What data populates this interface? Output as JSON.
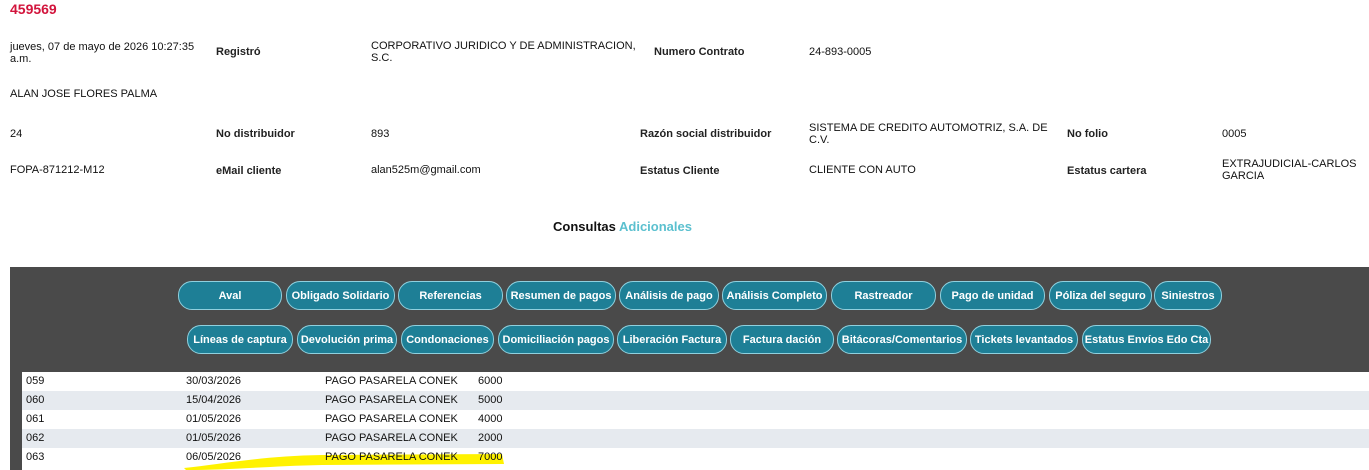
{
  "record": {
    "id": "459569",
    "datetime": "jueves, 07 de mayo de 2026 10:27:35 a.m.",
    "registro_label": "Registró",
    "registro_value": "CORPORATIVO JURIDICO Y DE ADMINISTRACION, S.C.",
    "contrato_label": "Numero Contrato",
    "contrato_value": "24-893-0005",
    "cliente_nombre": "ALAN JOSE FLORES PALMA",
    "num": "24",
    "distribuidor_label": "No distribuidor",
    "distribuidor_value": "893",
    "razon_label": "Razón social distribuidor",
    "razon_value": "SISTEMA DE CREDITO AUTOMOTRIZ, S.A. DE C.V.",
    "folio_label": "No folio",
    "folio_value": "0005",
    "rfc": "FOPA-871212-M12",
    "email_label": "eMail cliente",
    "email_value": "alan525m@gmail.com",
    "estatus_cliente_label": "Estatus Cliente",
    "estatus_cliente_value": "CLIENTE CON AUTO",
    "estatus_cartera_label": "Estatus cartera",
    "estatus_cartera_value": "EXTRAJUDICIAL-CARLOS GARCIA"
  },
  "consultas": {
    "part1": "Consultas",
    "part2": "Adicionales"
  },
  "buttons_row1": [
    "Aval",
    "Obligado Solidario",
    "Referencias",
    "Resumen de pagos",
    "Análisis de pago",
    "Análisis Completo",
    "Rastreador",
    "Pago de unidad",
    "Póliza del seguro",
    "Siniestros"
  ],
  "buttons_row2": [
    "Líneas de captura",
    "Devolución prima",
    "Condonaciones",
    "Domiciliación pagos",
    "Liberación Factura",
    "Factura dación",
    "Bitácoras/Comentarios",
    "Tickets levantados",
    "Estatus Envíos Edo Cta"
  ],
  "payments": [
    {
      "num": "059",
      "date": "30/03/2026",
      "concept": "PAGO PASARELA CONEK",
      "amount": "6000"
    },
    {
      "num": "060",
      "date": "15/04/2026",
      "concept": "PAGO PASARELA CONEK",
      "amount": "5000"
    },
    {
      "num": "061",
      "date": "01/05/2026",
      "concept": "PAGO PASARELA CONEK",
      "amount": "4000"
    },
    {
      "num": "062",
      "date": "01/05/2026",
      "concept": "PAGO PASARELA CONEK",
      "amount": "2000"
    },
    {
      "num": "063",
      "date": "06/05/2026",
      "concept": "PAGO PASARELA CONEK",
      "amount": "7000"
    }
  ],
  "colors": {
    "accent_red": "#d2143c",
    "button_bg": "#1e7f96",
    "panel_bg": "#4a4a4a",
    "highlight": "#fff200",
    "teal_text": "#5bc0cf"
  }
}
